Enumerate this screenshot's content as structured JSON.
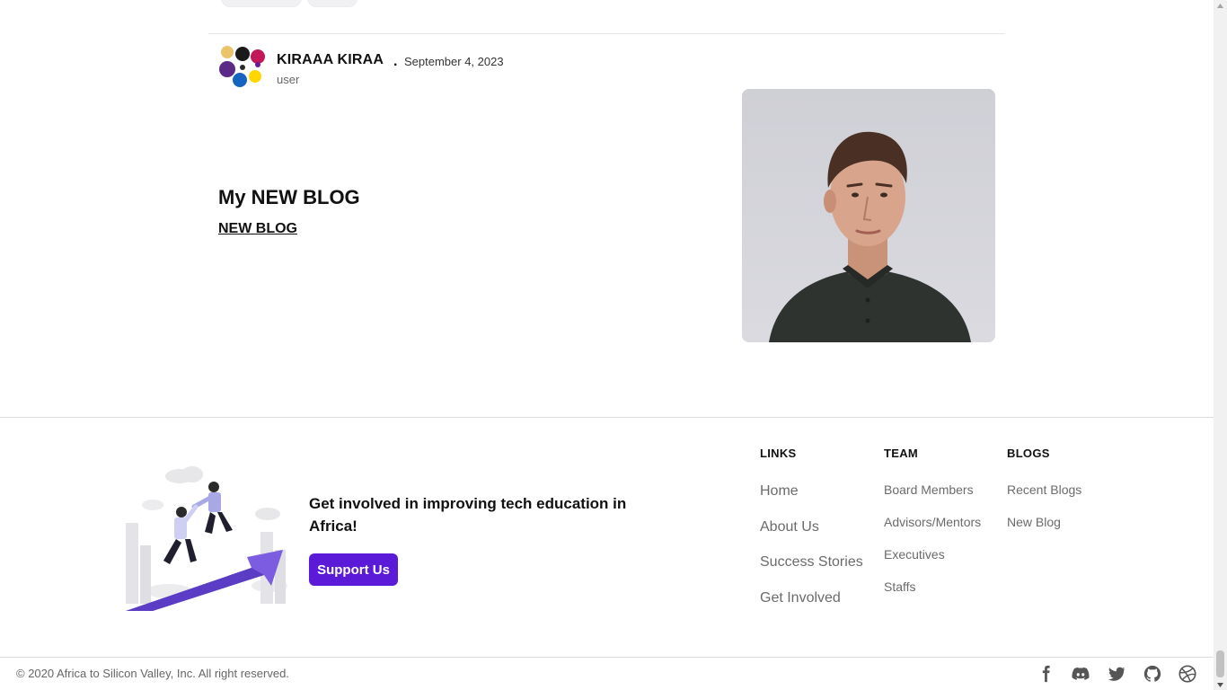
{
  "post": {
    "author_name": "KIRAAA KIRAA",
    "separator": ".",
    "date": "September 4, 2023",
    "role": "user",
    "title": "My NEW BLOG",
    "link_text": "NEW BLOG"
  },
  "footer": {
    "cta_text": "Get involved in improving tech education in Africa!",
    "support_label": "Support Us",
    "columns": {
      "links": {
        "heading": "LINKS",
        "items": [
          "Home",
          "About Us",
          "Success Stories",
          "Get Involved"
        ]
      },
      "team": {
        "heading": "TEAM",
        "items": [
          "Board Members",
          "Advisors/Mentors",
          "Executives",
          "Staffs"
        ]
      },
      "blogs": {
        "heading": "BLOGS",
        "items": [
          "Recent Blogs",
          "New Blog"
        ]
      }
    },
    "copyright": "© 2020 Africa to Silicon Valley, Inc. All right reserved.",
    "social": [
      "facebook-icon",
      "discord-icon",
      "twitter-icon",
      "github-icon",
      "dribbble-icon"
    ]
  },
  "colors": {
    "brand": "#5a1ad8",
    "link_gray": "#6b6b6b",
    "text": "#111111"
  }
}
